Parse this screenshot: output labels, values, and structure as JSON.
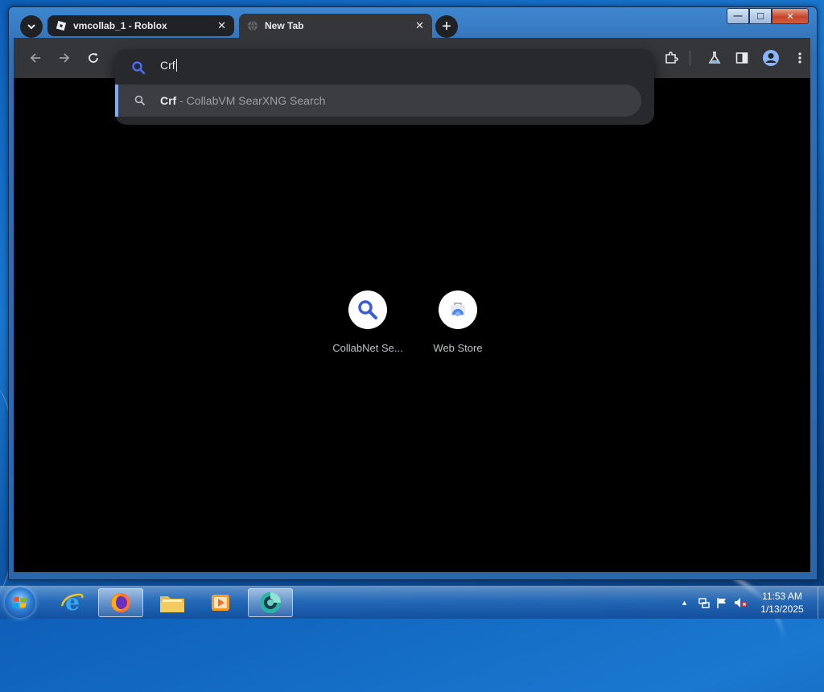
{
  "browser": {
    "tabs": [
      {
        "title": "vmcollab_1 - Roblox",
        "close": "✕"
      },
      {
        "title": "New Tab",
        "close": "✕"
      }
    ],
    "new_tab": "+",
    "window_controls": {
      "minimize": "—",
      "maximize": "☐",
      "close": "✕"
    }
  },
  "omnibox": {
    "query": "Crf",
    "suggestion": {
      "query": "Crf",
      "engine": "- CollabVM SearXNG Search"
    }
  },
  "shortcuts": [
    {
      "label": "CollabNet Se...",
      "icon": "search-icon"
    },
    {
      "label": "Web Store",
      "icon": "web-store-icon"
    }
  ],
  "taskbar": {
    "time": "11:53 AM",
    "date": "1/13/2025",
    "tray_arrow": "▲"
  },
  "colors": {
    "accent": "#7cacf8",
    "tab_active": "#35363a",
    "page_bg": "#000000"
  }
}
